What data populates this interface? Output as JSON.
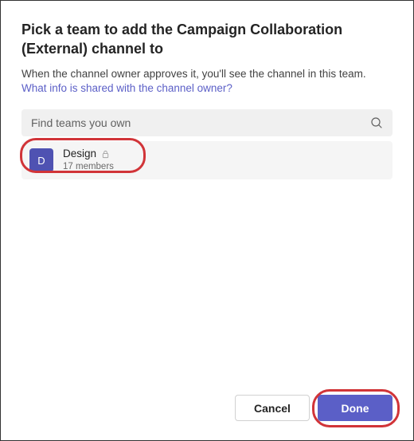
{
  "dialog": {
    "title": "Pick a team to add the Campaign Collaboration (External) channel to",
    "description": "When the channel owner approves it, you'll see the channel in this team. ",
    "link_text": "What info is shared with the channel owner?"
  },
  "search": {
    "placeholder": "Find teams you own"
  },
  "teams": [
    {
      "avatar_letter": "D",
      "name": "Design",
      "members": "17 members"
    }
  ],
  "footer": {
    "cancel": "Cancel",
    "done": "Done"
  }
}
